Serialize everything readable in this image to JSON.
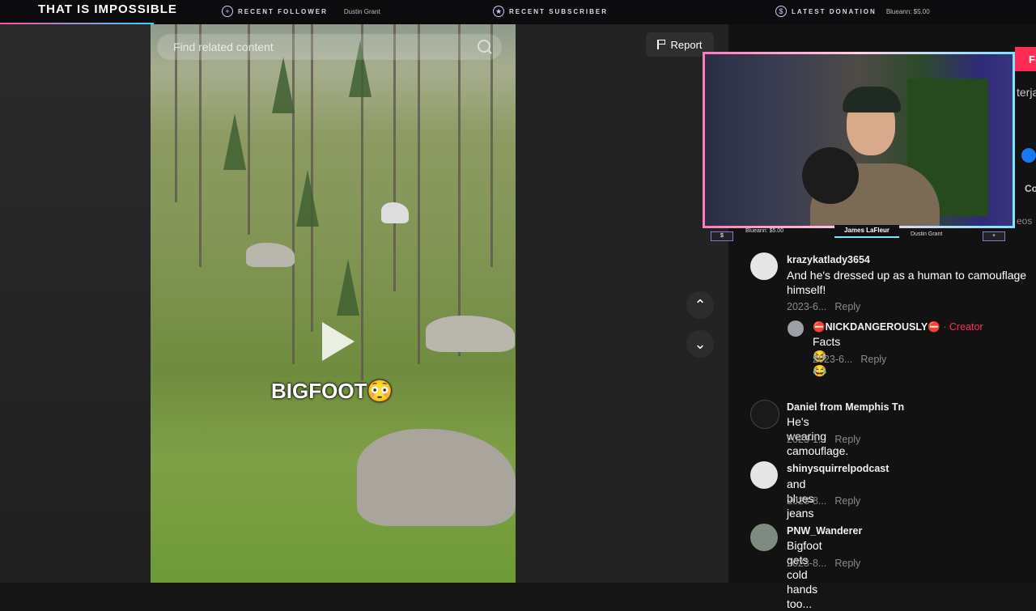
{
  "overlay": {
    "stream_title": "THAT IS IMPOSSIBLE",
    "recent_follower_label": "RECENT FOLLOWER",
    "recent_follower_name": "Dustin Grant",
    "recent_subscriber_label": "RECENT SUBSCRIBER",
    "latest_donation_label": "LATEST DONATION",
    "latest_donation_value": "Blueann: $5.00",
    "cam_name": "James LaFleur",
    "cam_left_value": "Blueann: $5.00",
    "cam_right_value": "Dustin Grant"
  },
  "search": {
    "placeholder": "Find related content"
  },
  "video": {
    "caption": "BIGFOOT😳"
  },
  "report_label": "Report",
  "side_snippets": [
    "Fo",
    "terja",
    "Co",
    "eos"
  ],
  "comments": [
    {
      "user": "krazykatlady3654",
      "text": "And he's dressed up as a human to camouflage himself!",
      "date": "2023-6...",
      "reply": "Reply"
    },
    {
      "user": "⛔NICKDANGEROUSLY⛔",
      "creator": "· Creator",
      "text": "Facts 😂😂",
      "date": "2023-6...",
      "reply": "Reply"
    },
    {
      "user": "Daniel from Memphis Tn",
      "text": "He's wearing camouflage.",
      "date": "2023-1...",
      "reply": "Reply"
    },
    {
      "user": "shinysquirrelpodcast",
      "text": "and blues jeans",
      "date": "2023-8...",
      "reply": "Reply"
    },
    {
      "user": "PNW_Wanderer",
      "text": "Bigfoot gets cold hands too...",
      "date": "2023-8...",
      "reply": "Reply"
    }
  ]
}
